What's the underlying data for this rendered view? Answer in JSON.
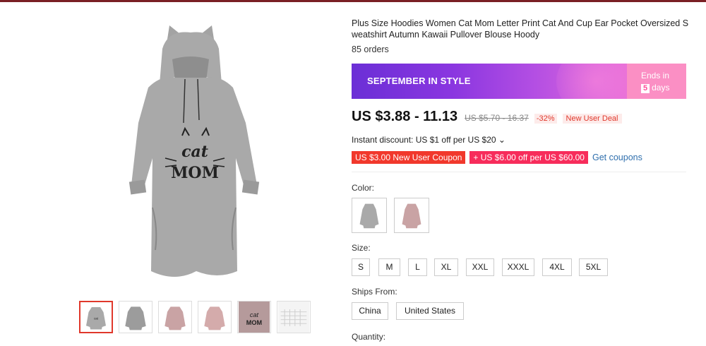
{
  "product": {
    "title": "Plus Size Hoodies Women Cat Mom Letter Print Cat And Cup Ear Pocket Oversized Sweatshirt Autumn Kawaii Pullover Blouse Hoody",
    "orders": "85 orders"
  },
  "banner": {
    "label": "SEPTEMBER IN STYLE",
    "ends_in": "Ends in",
    "days_num": "5",
    "days": "days"
  },
  "price": {
    "current": "US $3.88 - 11.13",
    "original": "US $5.70 - 16.37",
    "discount": "-32%",
    "deal": "New User Deal"
  },
  "instant_discount": "Instant discount: US $1 off per US $20 ⌄",
  "coupons": {
    "new_user": "US $3.00 New User Coupon",
    "store": "+ US $6.00 off per US $60.00",
    "get": "Get coupons"
  },
  "print_text": {
    "line1": "cat",
    "line2": "MOM"
  },
  "colors": {
    "gray": "#a9a9a9",
    "pink": "#c9a3a4",
    "accent_red": "#e0382b"
  },
  "color_label": "Color:",
  "size_label": "Size:",
  "sizes": [
    "S",
    "M",
    "L",
    "XL",
    "XXL",
    "XXXL",
    "4XL",
    "5XL"
  ],
  "ships_label": "Ships From:",
  "ships": [
    "China",
    "United States"
  ],
  "quantity_label": "Quantity:"
}
